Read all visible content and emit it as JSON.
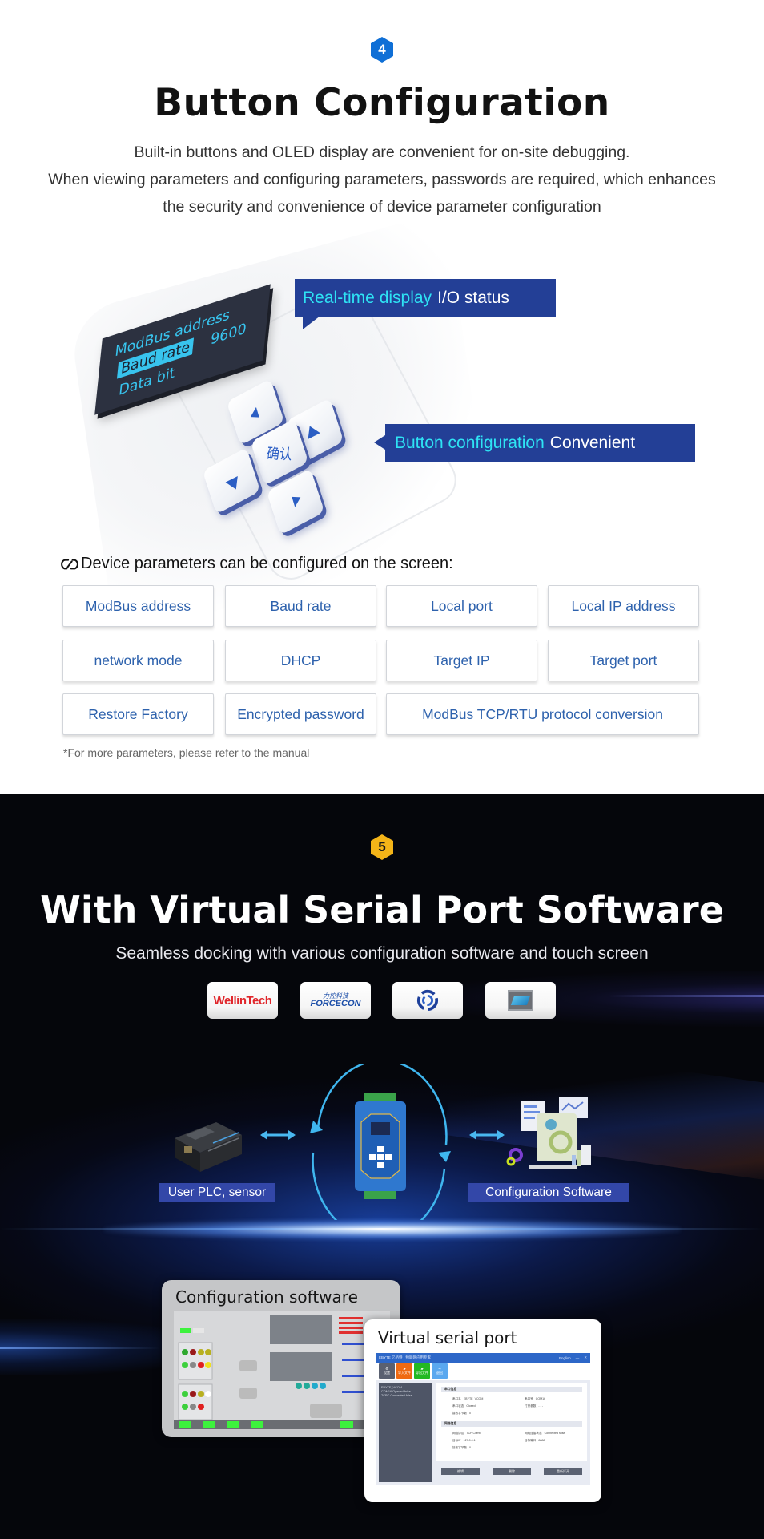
{
  "section4": {
    "badge": "4",
    "badge_color": "#0f6fd6",
    "title": "Button Configuration",
    "description": [
      "Built-in buttons and OLED display are convenient for on-site debugging.",
      "When viewing parameters and configuring parameters, passwords are required, which enhances",
      "the security and convenience of device parameter configuration"
    ],
    "oled": {
      "line1": "ModBus address",
      "line2": "Baud rate",
      "line2_value": "9600",
      "line3": "Data bit"
    },
    "keypad": {
      "up": "▲",
      "right": "▶",
      "ok": "确认",
      "left": "◀",
      "down": "▼"
    },
    "callouts": [
      {
        "highlight": "Real-time display",
        "text": "I/O status"
      },
      {
        "highlight": "Button configuration",
        "text": "Convenient"
      }
    ],
    "params_heading": "Device parameters can be configured on the screen:",
    "params": [
      "ModBus address",
      "Baud rate",
      "Local port",
      "Local IP address",
      "network mode",
      "DHCP",
      "Target IP",
      "Target port",
      "Restore Factory",
      "Encrypted password",
      "ModBus TCP/RTU protocol conversion"
    ],
    "footnote": "*For more parameters, please refer to the manual"
  },
  "section5": {
    "badge": "5",
    "badge_color": "#f4b418",
    "title": "With Virtual Serial Port Software",
    "subtitle": "Seamless docking with various configuration software and touch screen",
    "logos": [
      {
        "name": "WellinTech",
        "text": "WellinTech"
      },
      {
        "name": "ForceCon",
        "text_cn": "力控科技",
        "text_en": "FORCECON"
      },
      {
        "name": "swirl-logo"
      },
      {
        "name": "touch-screen-logo"
      }
    ],
    "diagram": {
      "left_label": "User PLC, sensor",
      "right_label": "Configuration Software"
    },
    "screenshots": {
      "config_title": "Configuration software",
      "vsp_title": "Virtual serial port",
      "vsp_app": {
        "window_title": "EBYTE 亿佰特 · 物联网应用专家",
        "language": "English",
        "tools": [
          "设置",
          "导入文件",
          "导出文件",
          "退出"
        ],
        "tree": [
          "EBYTE_VCOM",
          "COM16 Opened  false",
          "TCPC Connected false"
        ],
        "section_serial": "串口信息",
        "section_network": "网络信息",
        "rows_serial": [
          {
            "k1": "串口名",
            "v1": "EBYTE_VCOM",
            "k2": "串口号",
            "v2": "COM16"
          },
          {
            "k1": "串口状态",
            "v1": "Closed",
            "k2": "打开参数",
            "v2": "- - -"
          },
          {
            "k1": "接收字节数",
            "v1": "0"
          }
        ],
        "rows_network": [
          {
            "k1": "网络协议",
            "v1": "TCP Client",
            "k2": "网络连接状态",
            "v2": "Connected false"
          },
          {
            "k1": "目标IP",
            "v1": "127.0.0.1",
            "k2": "目标端口",
            "v2": "8888"
          },
          {
            "k1": "接收字节数",
            "v1": "0"
          }
        ],
        "buttons": [
          "编辑",
          "删除",
          "重新打开"
        ]
      }
    }
  }
}
